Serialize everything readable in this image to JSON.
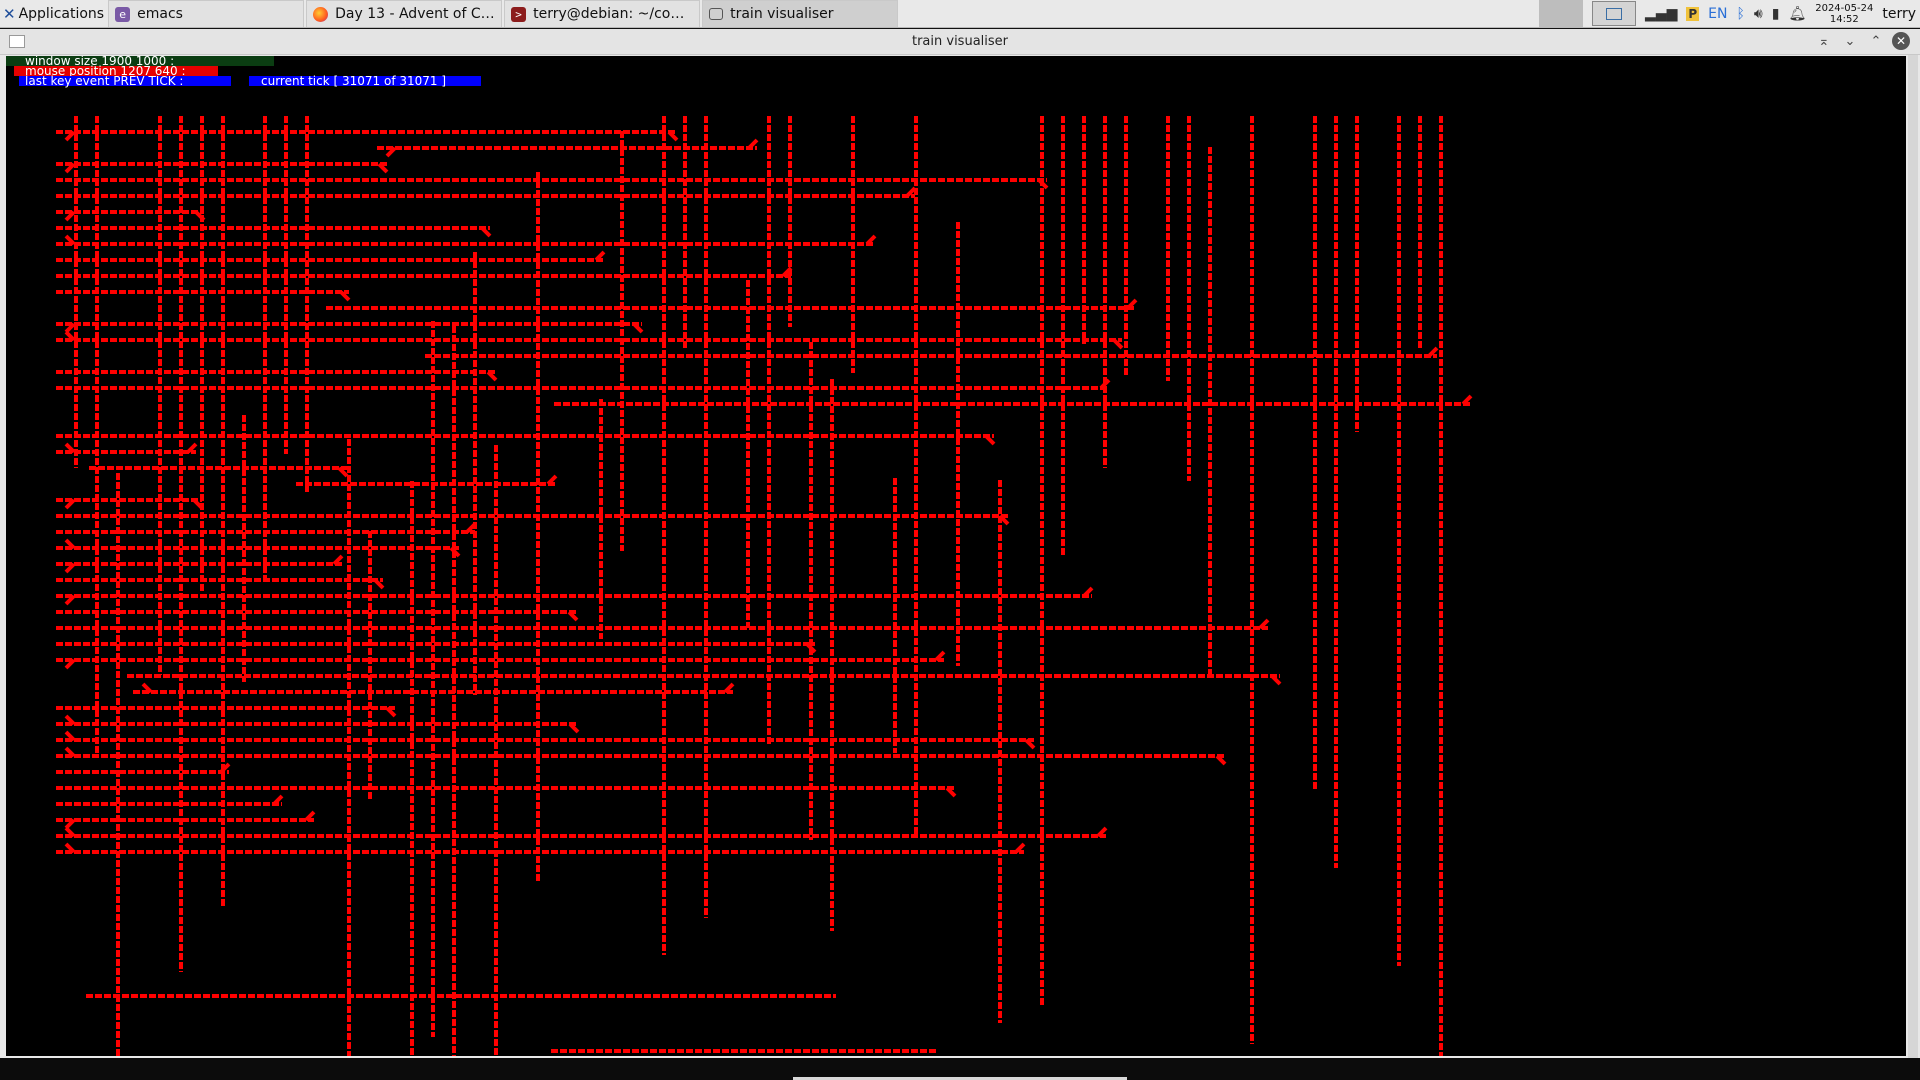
{
  "taskbar": {
    "menu_label": "Applications",
    "tasks": [
      {
        "label": "emacs",
        "icon": "emacs-icon"
      },
      {
        "label": "Day 13 - Advent of Code ...",
        "icon": "firefox-icon"
      },
      {
        "label": "terry@debian: ~/code/ad...",
        "icon": "terminal-icon"
      },
      {
        "label": "train visualiser",
        "icon": "window-icon",
        "active": true
      }
    ],
    "tray": {
      "keyboard_layout": "EN",
      "date": "2024-05-24",
      "time": "14:52",
      "user": "terry"
    }
  },
  "window": {
    "title": "train visualiser",
    "hud": {
      "window_size": "window size 1900 1000 :",
      "mouse_position": "mouse position 1207 640 :",
      "last_key_event": "last key event PREV TICK :",
      "current_tick": "current tick [ 31071 of 31071 ]"
    },
    "track_color": "#ff0000",
    "background_color": "#000000"
  }
}
